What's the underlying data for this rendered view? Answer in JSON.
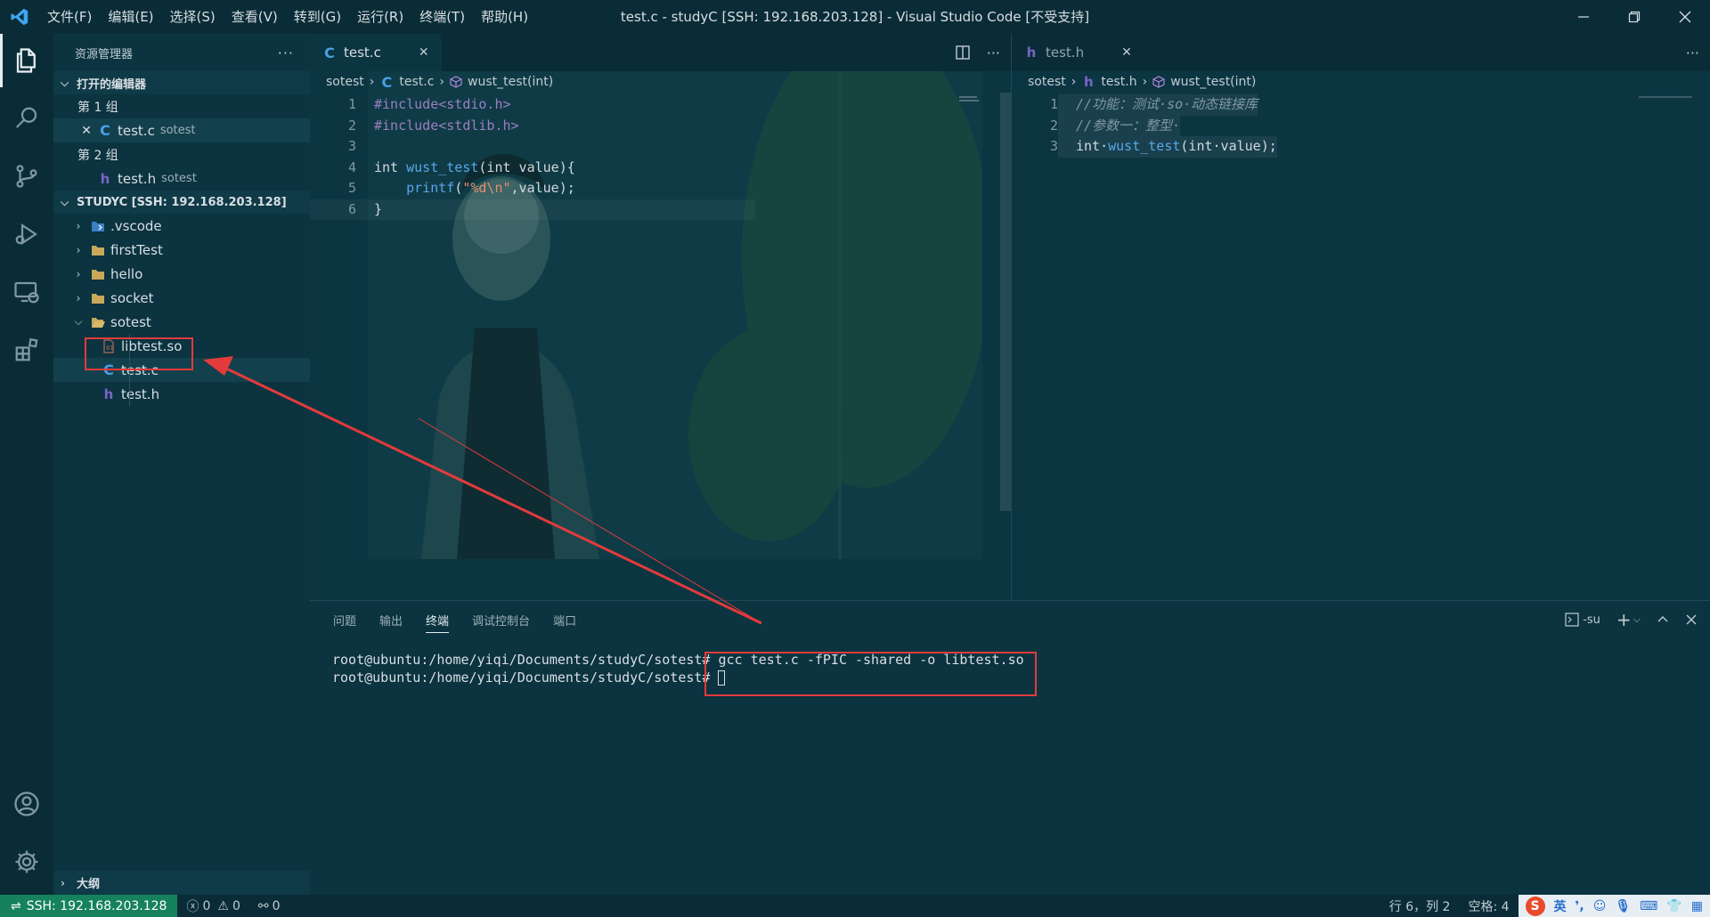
{
  "app": {
    "window_title": "test.c - studyC [SSH: 192.168.203.128] - Visual Studio Code [不受支持]",
    "menu": [
      "文件(F)",
      "编辑(E)",
      "选择(S)",
      "查看(V)",
      "转到(G)",
      "运行(R)",
      "终端(T)",
      "帮助(H)"
    ]
  },
  "sidebar": {
    "title": "资源管理器",
    "open_editors": {
      "label": "打开的编辑器",
      "groups": [
        {
          "label": "第 1 组",
          "file": "test.c",
          "desc": "sotest"
        },
        {
          "label": "第 2 组",
          "file": "test.h",
          "desc": "sotest"
        }
      ]
    },
    "workspace": {
      "label": "STUDYC [SSH: 192.168.203.128]",
      "folders": [
        ".vscode",
        "firstTest",
        "hello",
        "socket",
        "sotest"
      ],
      "sotest_files": [
        "libtest.so",
        "test.c",
        "test.h"
      ]
    },
    "outline_label": "大纲"
  },
  "editor_left": {
    "tab_label": "test.c",
    "breadcrumb": [
      "sotest",
      "test.c",
      "wust_test(int)"
    ],
    "lines": [
      "1",
      "2",
      "3",
      "4",
      "5",
      "6"
    ],
    "code": {
      "l1": "#include<stdio.h>",
      "l2": "#include<stdlib.h>",
      "l4_kw": "int",
      "l4_fn": "wust_test",
      "l4_rest": "(int value){",
      "l5_fn": "printf",
      "l5_str": "\"%d\\n\"",
      "l5_rest": ",value);",
      "l6": "}"
    }
  },
  "editor_right": {
    "tab_label": "test.h",
    "breadcrumb": [
      "sotest",
      "test.h",
      "wust_test(int)"
    ],
    "lines": [
      "1",
      "2",
      "3"
    ],
    "code": {
      "l1": "//功能：测试·so·动态链接库",
      "l2": "//参数一：整型·",
      "l3_kw": "int",
      "l3_fn": "wust_test",
      "l3_rest": "(int·value);"
    }
  },
  "panel": {
    "tabs": [
      "问题",
      "输出",
      "终端",
      "调试控制台",
      "端口"
    ],
    "active_tab": "终端",
    "shell_label": "-su",
    "terminal_lines": [
      "root@ubuntu:/home/yiqi/Documents/studyC/sotest# gcc test.c -fPIC -shared -o libtest.so",
      "root@ubuntu:/home/yiqi/Documents/studyC/sotest# "
    ]
  },
  "statusbar": {
    "remote": "SSH: 192.168.203.128",
    "errors": "0",
    "warnings": "0",
    "ports": "0",
    "position": "行 6，列 2",
    "spaces": "空格: 4",
    "ime_label": "英"
  },
  "colors": {
    "annotation": "#e33b3b",
    "remote_bg": "#16825d",
    "background": "#0b3340"
  }
}
